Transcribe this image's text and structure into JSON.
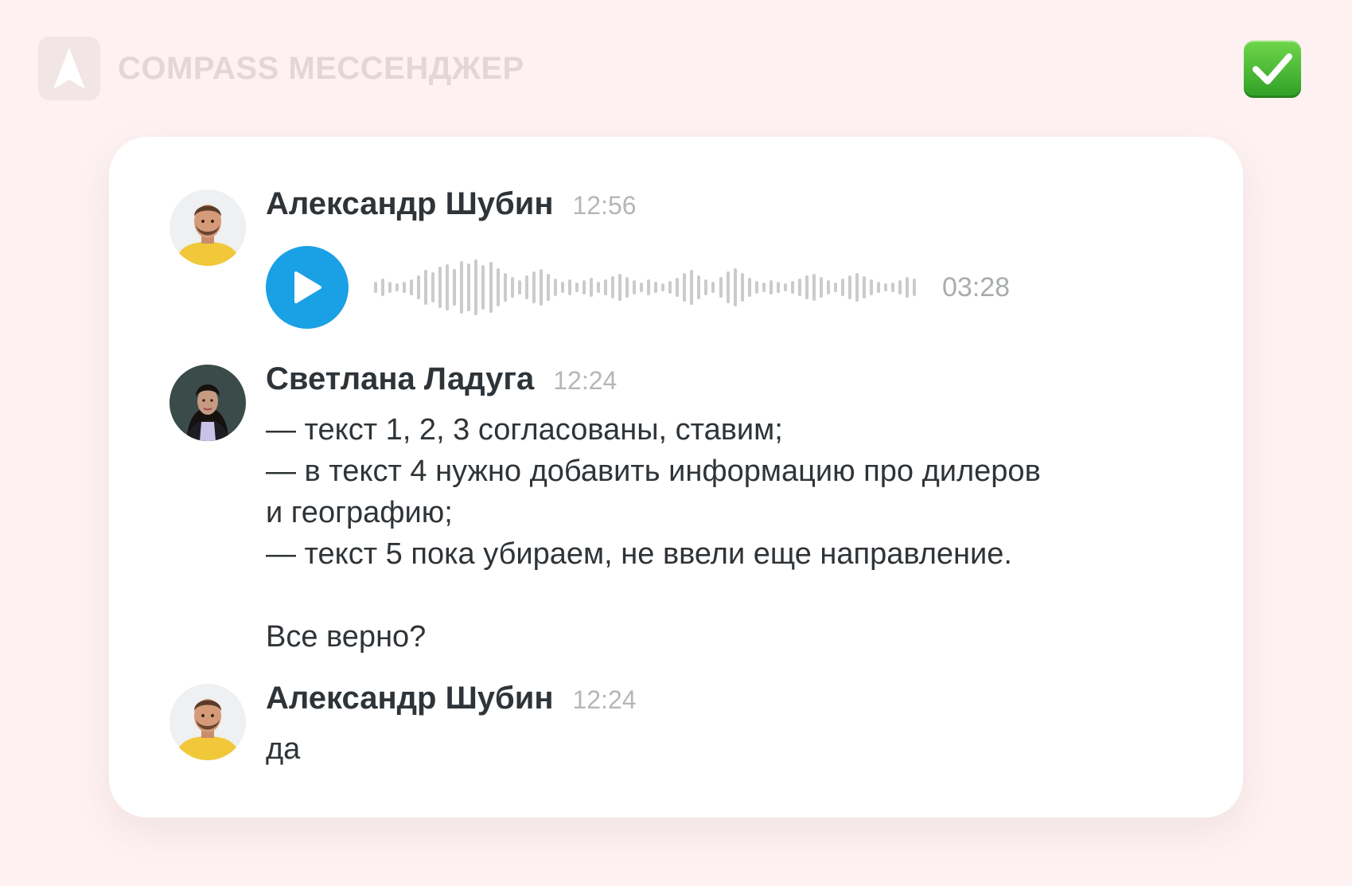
{
  "header": {
    "app_name": "COMPASS МЕССЕНДЖЕР",
    "logo_icon": "compass-logo-icon",
    "status_icon": "check-mark-button-icon"
  },
  "colors": {
    "page_background": "#fdf1f1",
    "card_background": "#ffffff",
    "accent_play": "#1aa0e4",
    "check_badge": "#3cb531",
    "text_primary": "#2f3438",
    "text_muted": "#b4b6b8"
  },
  "messages": [
    {
      "author": "Александр Шубин",
      "time": "12:56",
      "type": "voice",
      "duration": "03:28",
      "avatar_icon": "man-avatar"
    },
    {
      "author": "Светлана Ладуга",
      "time": "12:24",
      "type": "text",
      "text": "— текст 1, 2, 3 согласованы, ставим;\n— в текст 4 нужно добавить информацию про дилеров\nи географию;\n— текст 5 пока убираем, не ввели еще направление.\n\nВсе верно?",
      "avatar_icon": "woman-avatar"
    },
    {
      "author": "Александр Шубин",
      "time": "12:24",
      "type": "text",
      "text": "да",
      "avatar_icon": "man-avatar"
    }
  ]
}
